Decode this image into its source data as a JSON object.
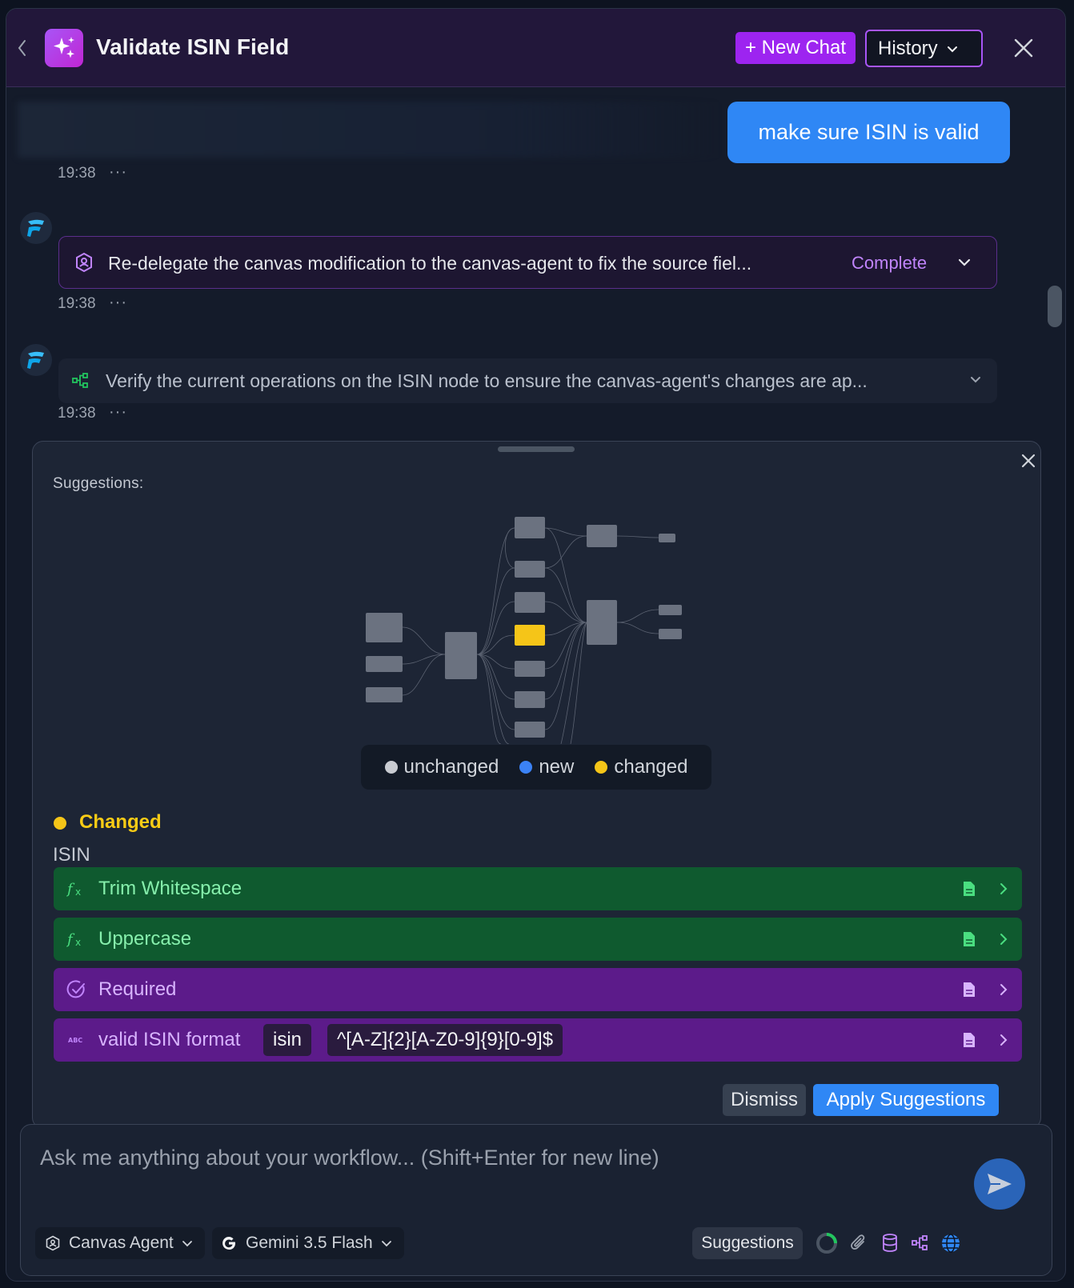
{
  "header": {
    "title": "Validate ISIN Field",
    "new_chat_label": "+ New Chat",
    "history_label": "History"
  },
  "chat": {
    "user_message": "make sure ISIN is valid",
    "timestamps": [
      "19:38",
      "19:38",
      "19:38"
    ],
    "more_label": "···",
    "task": {
      "text": "Re-delegate the canvas modification to the canvas-agent to fix the source fiel...",
      "status": "Complete"
    },
    "verify": {
      "text": "Verify the current operations on the ISIN node to ensure the canvas-agent's changes are ap..."
    }
  },
  "suggestions": {
    "label": "Suggestions:",
    "legend": [
      {
        "label": "unchanged",
        "color": "#c9ccd2"
      },
      {
        "label": "new",
        "color": "#3b82f6"
      },
      {
        "label": "changed",
        "color": "#f5c518"
      }
    ],
    "group_label": "Changed",
    "node_name": "ISIN",
    "operations": [
      {
        "label": "Trim Whitespace",
        "kind": "transform"
      },
      {
        "label": "Uppercase",
        "kind": "transform"
      },
      {
        "label": "Required",
        "kind": "validation"
      },
      {
        "label": "valid ISIN format",
        "kind": "validation",
        "chips": [
          "isin",
          "^[A-Z]{2}[A-Z0-9]{9}[0-9]$"
        ]
      }
    ],
    "dismiss_label": "Dismiss",
    "apply_label": "Apply Suggestions"
  },
  "composer": {
    "placeholder": "Ask me anything about your workflow... (Shift+Enter for new line)",
    "agent_label": "Canvas Agent",
    "model_label": "Gemini 3.5 Flash",
    "suggestions_toggle": "Suggestions"
  },
  "colors": {
    "accent_purple": "#9d24f0",
    "accent_blue": "#2f87f5",
    "changed_yellow": "#f5c518",
    "transform_green": "#0f5a2f",
    "validation_purple": "#5c1b8a"
  },
  "icons": {
    "back": "chevron-left-icon",
    "logo": "sparkles-icon",
    "close": "close-icon",
    "task": "agent-badge-icon",
    "verify": "flow-nodes-icon",
    "transform": "function-icon",
    "validation": "check-circle-icon",
    "format": "abc-icon",
    "send": "send-icon"
  }
}
